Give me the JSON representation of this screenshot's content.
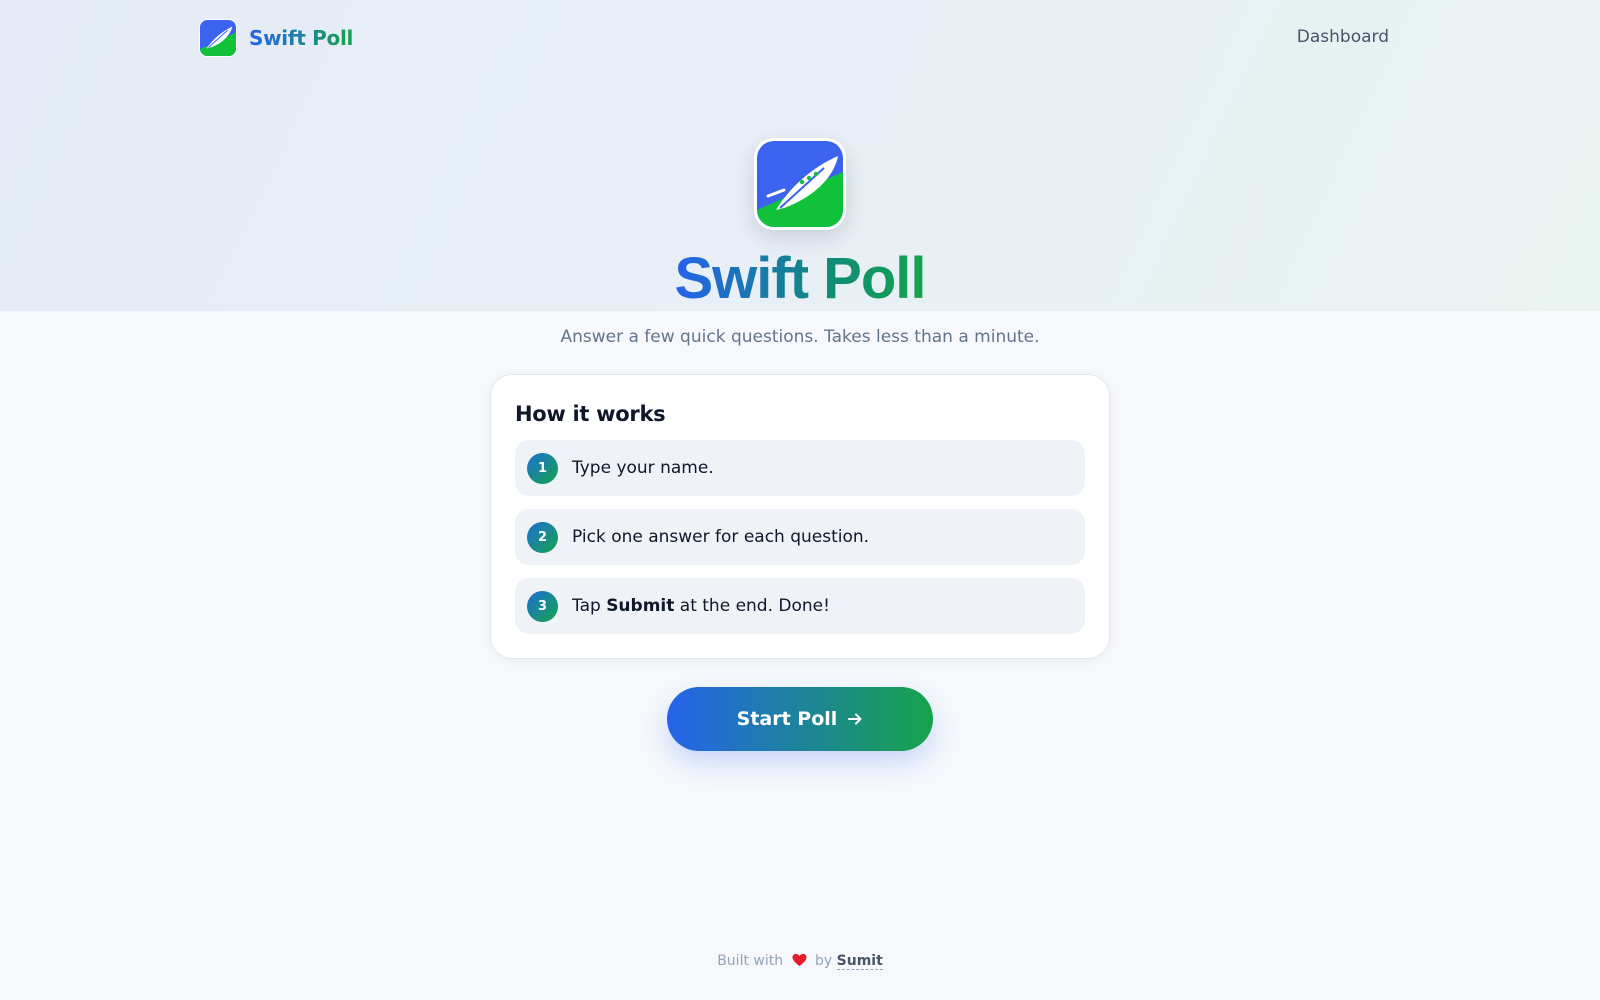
{
  "nav": {
    "brand_name": "Swift Poll",
    "brand_logo_icon": "swift-poll-feather-logo",
    "dashboard_label": "Dashboard"
  },
  "hero": {
    "logo_icon": "swift-poll-feather-logo",
    "title": "Swift Poll",
    "subtitle": "Answer a few quick questions. Takes less than a minute."
  },
  "how_it_works": {
    "title": "How it works",
    "steps": [
      {
        "number": "1",
        "text": "Type your name.",
        "pre": "",
        "bold": "",
        "post": ""
      },
      {
        "number": "2",
        "text": "Pick one answer for each question.",
        "pre": "",
        "bold": "",
        "post": ""
      },
      {
        "number": "3",
        "text": "",
        "pre": "Tap ",
        "bold": "Submit",
        "post": " at the end. Done!"
      }
    ]
  },
  "cta": {
    "label": "Start Poll",
    "icon": "arrow-right-icon"
  },
  "footer": {
    "prefix": "Built with",
    "heart_icon": "heart-icon",
    "by": "by",
    "author": "Sumit"
  },
  "colors": {
    "brand_blue": "#2563eb",
    "brand_green": "#16a34a",
    "page_bg": "#f6f8fc",
    "heart_red": "#e11d2e"
  }
}
